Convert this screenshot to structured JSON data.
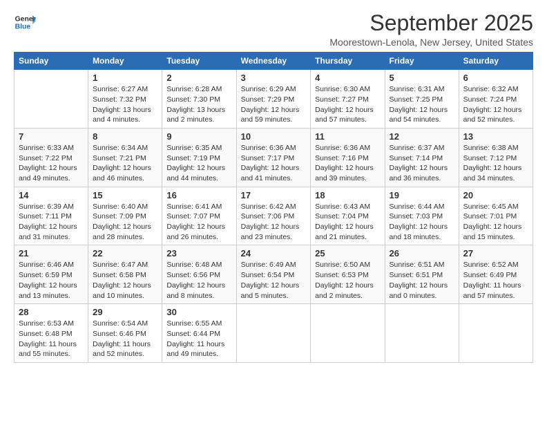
{
  "logo": {
    "line1": "General",
    "line2": "Blue"
  },
  "title": "September 2025",
  "location": "Moorestown-Lenola, New Jersey, United States",
  "weekdays": [
    "Sunday",
    "Monday",
    "Tuesday",
    "Wednesday",
    "Thursday",
    "Friday",
    "Saturday"
  ],
  "weeks": [
    [
      {
        "day": "",
        "sunrise": "",
        "sunset": "",
        "daylight": ""
      },
      {
        "day": "1",
        "sunrise": "Sunrise: 6:27 AM",
        "sunset": "Sunset: 7:32 PM",
        "daylight": "Daylight: 13 hours and 4 minutes."
      },
      {
        "day": "2",
        "sunrise": "Sunrise: 6:28 AM",
        "sunset": "Sunset: 7:30 PM",
        "daylight": "Daylight: 13 hours and 2 minutes."
      },
      {
        "day": "3",
        "sunrise": "Sunrise: 6:29 AM",
        "sunset": "Sunset: 7:29 PM",
        "daylight": "Daylight: 12 hours and 59 minutes."
      },
      {
        "day": "4",
        "sunrise": "Sunrise: 6:30 AM",
        "sunset": "Sunset: 7:27 PM",
        "daylight": "Daylight: 12 hours and 57 minutes."
      },
      {
        "day": "5",
        "sunrise": "Sunrise: 6:31 AM",
        "sunset": "Sunset: 7:25 PM",
        "daylight": "Daylight: 12 hours and 54 minutes."
      },
      {
        "day": "6",
        "sunrise": "Sunrise: 6:32 AM",
        "sunset": "Sunset: 7:24 PM",
        "daylight": "Daylight: 12 hours and 52 minutes."
      }
    ],
    [
      {
        "day": "7",
        "sunrise": "Sunrise: 6:33 AM",
        "sunset": "Sunset: 7:22 PM",
        "daylight": "Daylight: 12 hours and 49 minutes."
      },
      {
        "day": "8",
        "sunrise": "Sunrise: 6:34 AM",
        "sunset": "Sunset: 7:21 PM",
        "daylight": "Daylight: 12 hours and 46 minutes."
      },
      {
        "day": "9",
        "sunrise": "Sunrise: 6:35 AM",
        "sunset": "Sunset: 7:19 PM",
        "daylight": "Daylight: 12 hours and 44 minutes."
      },
      {
        "day": "10",
        "sunrise": "Sunrise: 6:36 AM",
        "sunset": "Sunset: 7:17 PM",
        "daylight": "Daylight: 12 hours and 41 minutes."
      },
      {
        "day": "11",
        "sunrise": "Sunrise: 6:36 AM",
        "sunset": "Sunset: 7:16 PM",
        "daylight": "Daylight: 12 hours and 39 minutes."
      },
      {
        "day": "12",
        "sunrise": "Sunrise: 6:37 AM",
        "sunset": "Sunset: 7:14 PM",
        "daylight": "Daylight: 12 hours and 36 minutes."
      },
      {
        "day": "13",
        "sunrise": "Sunrise: 6:38 AM",
        "sunset": "Sunset: 7:12 PM",
        "daylight": "Daylight: 12 hours and 34 minutes."
      }
    ],
    [
      {
        "day": "14",
        "sunrise": "Sunrise: 6:39 AM",
        "sunset": "Sunset: 7:11 PM",
        "daylight": "Daylight: 12 hours and 31 minutes."
      },
      {
        "day": "15",
        "sunrise": "Sunrise: 6:40 AM",
        "sunset": "Sunset: 7:09 PM",
        "daylight": "Daylight: 12 hours and 28 minutes."
      },
      {
        "day": "16",
        "sunrise": "Sunrise: 6:41 AM",
        "sunset": "Sunset: 7:07 PM",
        "daylight": "Daylight: 12 hours and 26 minutes."
      },
      {
        "day": "17",
        "sunrise": "Sunrise: 6:42 AM",
        "sunset": "Sunset: 7:06 PM",
        "daylight": "Daylight: 12 hours and 23 minutes."
      },
      {
        "day": "18",
        "sunrise": "Sunrise: 6:43 AM",
        "sunset": "Sunset: 7:04 PM",
        "daylight": "Daylight: 12 hours and 21 minutes."
      },
      {
        "day": "19",
        "sunrise": "Sunrise: 6:44 AM",
        "sunset": "Sunset: 7:03 PM",
        "daylight": "Daylight: 12 hours and 18 minutes."
      },
      {
        "day": "20",
        "sunrise": "Sunrise: 6:45 AM",
        "sunset": "Sunset: 7:01 PM",
        "daylight": "Daylight: 12 hours and 15 minutes."
      }
    ],
    [
      {
        "day": "21",
        "sunrise": "Sunrise: 6:46 AM",
        "sunset": "Sunset: 6:59 PM",
        "daylight": "Daylight: 12 hours and 13 minutes."
      },
      {
        "day": "22",
        "sunrise": "Sunrise: 6:47 AM",
        "sunset": "Sunset: 6:58 PM",
        "daylight": "Daylight: 12 hours and 10 minutes."
      },
      {
        "day": "23",
        "sunrise": "Sunrise: 6:48 AM",
        "sunset": "Sunset: 6:56 PM",
        "daylight": "Daylight: 12 hours and 8 minutes."
      },
      {
        "day": "24",
        "sunrise": "Sunrise: 6:49 AM",
        "sunset": "Sunset: 6:54 PM",
        "daylight": "Daylight: 12 hours and 5 minutes."
      },
      {
        "day": "25",
        "sunrise": "Sunrise: 6:50 AM",
        "sunset": "Sunset: 6:53 PM",
        "daylight": "Daylight: 12 hours and 2 minutes."
      },
      {
        "day": "26",
        "sunrise": "Sunrise: 6:51 AM",
        "sunset": "Sunset: 6:51 PM",
        "daylight": "Daylight: 12 hours and 0 minutes."
      },
      {
        "day": "27",
        "sunrise": "Sunrise: 6:52 AM",
        "sunset": "Sunset: 6:49 PM",
        "daylight": "Daylight: 11 hours and 57 minutes."
      }
    ],
    [
      {
        "day": "28",
        "sunrise": "Sunrise: 6:53 AM",
        "sunset": "Sunset: 6:48 PM",
        "daylight": "Daylight: 11 hours and 55 minutes."
      },
      {
        "day": "29",
        "sunrise": "Sunrise: 6:54 AM",
        "sunset": "Sunset: 6:46 PM",
        "daylight": "Daylight: 11 hours and 52 minutes."
      },
      {
        "day": "30",
        "sunrise": "Sunrise: 6:55 AM",
        "sunset": "Sunset: 6:44 PM",
        "daylight": "Daylight: 11 hours and 49 minutes."
      },
      {
        "day": "",
        "sunrise": "",
        "sunset": "",
        "daylight": ""
      },
      {
        "day": "",
        "sunrise": "",
        "sunset": "",
        "daylight": ""
      },
      {
        "day": "",
        "sunrise": "",
        "sunset": "",
        "daylight": ""
      },
      {
        "day": "",
        "sunrise": "",
        "sunset": "",
        "daylight": ""
      }
    ]
  ]
}
